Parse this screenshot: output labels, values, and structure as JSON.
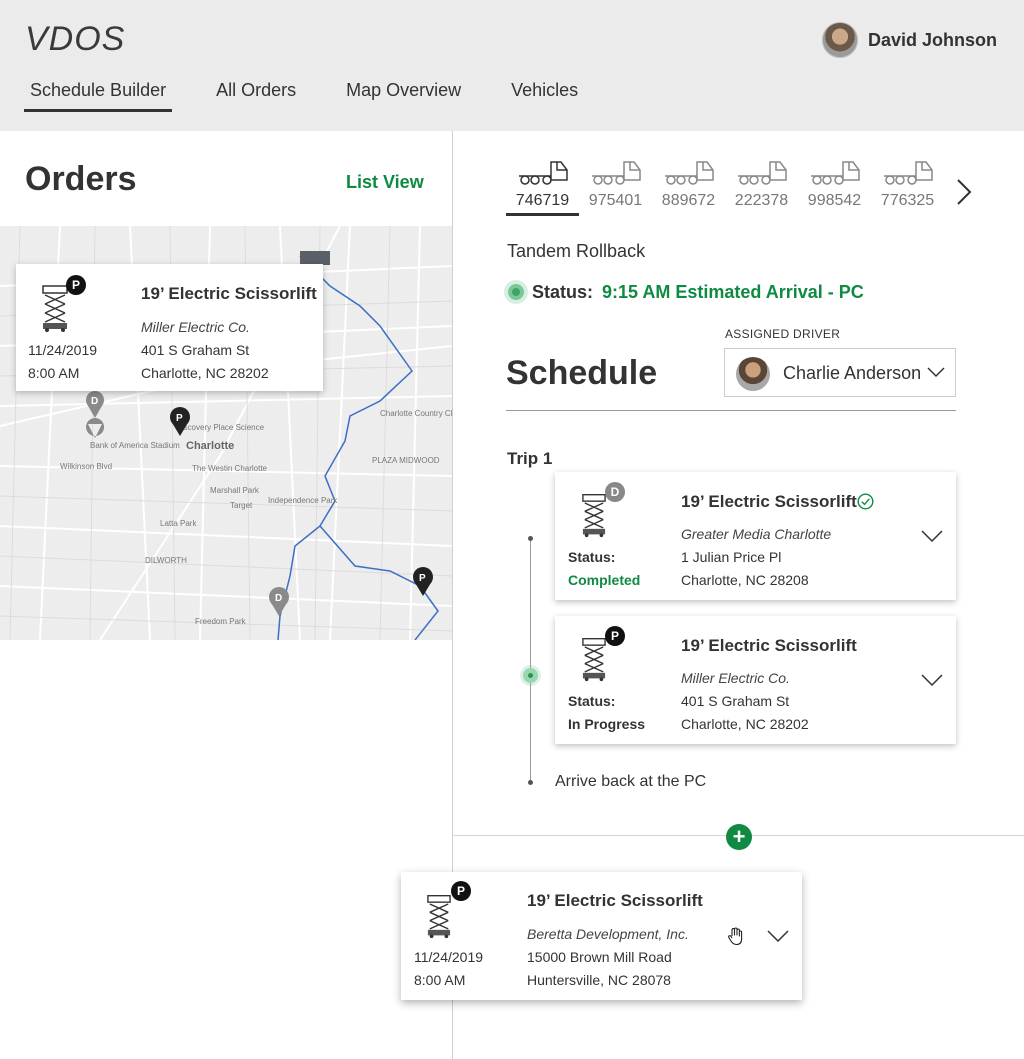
{
  "app": {
    "title": "VDOS"
  },
  "user": {
    "name": "David Johnson"
  },
  "nav": {
    "tabs": [
      "Schedule Builder",
      "All Orders",
      "Map Overview",
      "Vehicles"
    ],
    "active": "Schedule Builder"
  },
  "orders": {
    "title": "Orders",
    "list_view_label": "List View",
    "map_card": {
      "badge": "P",
      "title": "19’ Electric Scissorlift",
      "company": "Miller Electric Co.",
      "date": "11/24/2019",
      "time": "8:00 AM",
      "address1": "401 S Graham St",
      "address2": "Charlotte, NC 28202"
    },
    "map_labels": [
      "Charlotte",
      "Bank of America Stadium",
      "Discovery Place Science",
      "The Westin Charlotte",
      "Marshall Park",
      "Target",
      "Independence Park",
      "Latta Park",
      "DILWORTH",
      "Freedom Park",
      "PLAZA MIDWOOD",
      "Charlotte Country Club",
      "Wilkinson Blvd"
    ],
    "map_markers": [
      "D",
      "P",
      "P",
      "D"
    ]
  },
  "vehicles": {
    "ids": [
      "746719",
      "975401",
      "889672",
      "222378",
      "998542",
      "776325"
    ],
    "active": "746719"
  },
  "vehicle": {
    "type": "Tandem Rollback",
    "status_label": "Status:",
    "status_value": "9:15 AM Estimated Arrival - PC"
  },
  "schedule": {
    "title": "Schedule",
    "assigned_driver_label": "ASSIGNED DRIVER",
    "driver_name": "Charlie Anderson",
    "trip_label": "Trip 1",
    "stops": [
      {
        "badge": "D",
        "title": "19’ Electric Scissorlift",
        "company": "Greater Media Charlotte",
        "status_label": "Status:",
        "status_value": "Completed",
        "address1": "1 Julian Price Pl",
        "address2": "Charlotte, NC 28208"
      },
      {
        "badge": "P",
        "title": "19’ Electric Scissorlift",
        "company": "Miller Electric Co.",
        "status_label": "Status:",
        "status_value": "In Progress",
        "address1": "401 S Graham St",
        "address2": "Charlotte, NC 28202"
      }
    ],
    "arrive_back": "Arrive back at the PC",
    "add_label": "+"
  },
  "dragging_card": {
    "badge": "P",
    "title": "19’ Electric Scissorlift",
    "company": "Beretta Development, Inc.",
    "date": "11/24/2019",
    "time": "8:00 AM",
    "address1": "15000 Brown Mill Road",
    "address2": "Huntersville, NC 28078"
  },
  "colors": {
    "accent": "#0f8a43",
    "header_bg": "#ebebeb",
    "route": "#3b6fc4"
  }
}
